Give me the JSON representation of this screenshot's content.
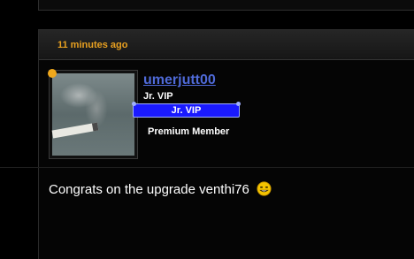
{
  "post": {
    "timestamp": "11 minutes ago",
    "author": {
      "username": "umerjutt00",
      "title": "Jr. VIP",
      "rank_label": "Jr. VIP",
      "member_type": "Premium Member",
      "online_status_color": "#f0a81c"
    },
    "message": {
      "text": "Congrats on the upgrade venthi76",
      "emoji": "smile-emoji"
    }
  },
  "colors": {
    "background": "#000000",
    "username_link": "#4f6ad8",
    "timestamp": "#e8a020",
    "rank_badge": "#1a1aff"
  }
}
